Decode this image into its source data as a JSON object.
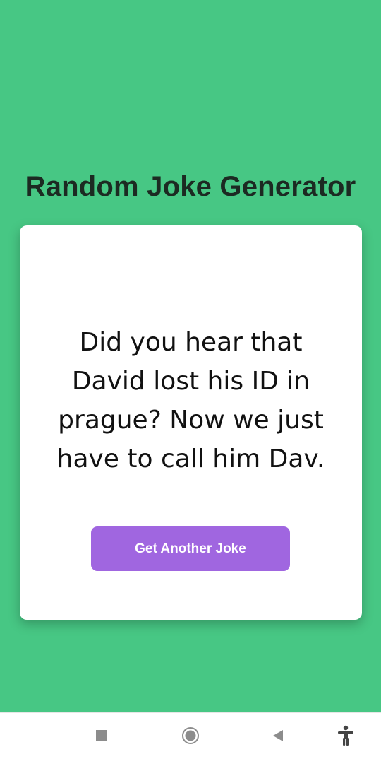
{
  "app": {
    "title": "Random Joke Generator",
    "joke_text": "Did you hear that David lost his ID in prague? Now we just have to call him Dav.",
    "button_label": "Get Another Joke"
  },
  "colors": {
    "background": "#47c784",
    "card": "#ffffff",
    "button": "#a066e0",
    "title_text": "#1c2a22"
  },
  "navbar": {
    "icons": [
      "recents-icon",
      "home-icon",
      "back-icon",
      "accessibility-icon"
    ]
  }
}
